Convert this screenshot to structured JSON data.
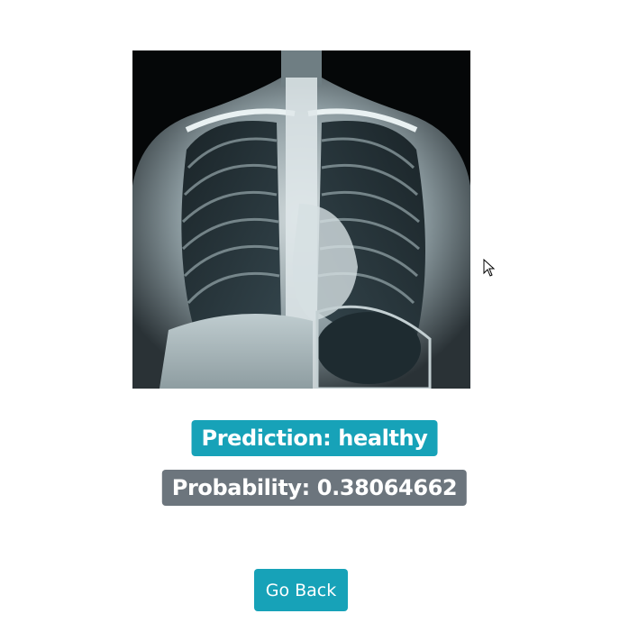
{
  "result": {
    "image_alt": "chest x-ray image",
    "prediction_label": "Prediction: healthy",
    "probability_label": "Probability: 0.38064662"
  },
  "actions": {
    "go_back_label": "Go Back"
  },
  "colors": {
    "info": "#17a2b8",
    "secondary": "#6c757d"
  },
  "icons": {
    "cursor": "mouse-pointer-icon"
  }
}
